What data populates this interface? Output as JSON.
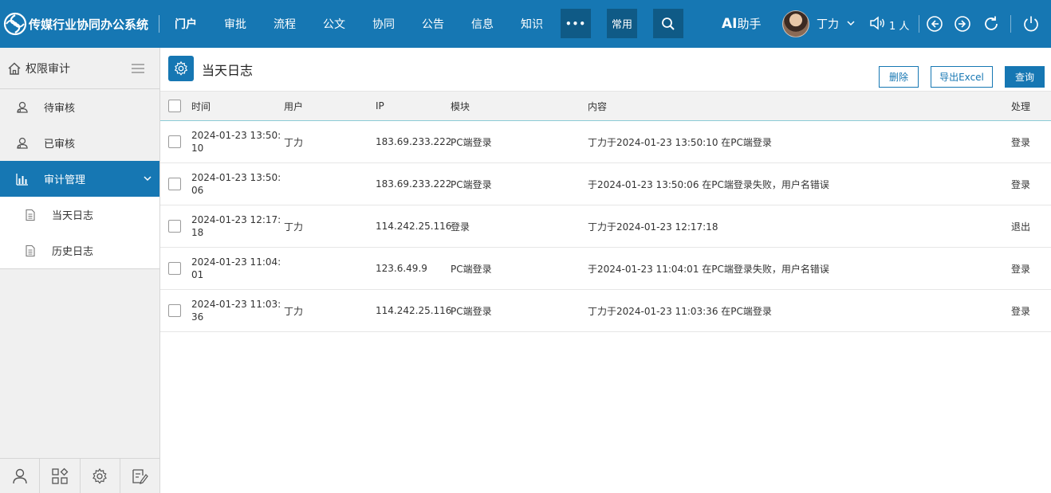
{
  "app": {
    "title": "传媒行业协同办公系统"
  },
  "nav": {
    "items": [
      "门户",
      "审批",
      "流程",
      "公文",
      "协同",
      "公告",
      "信息",
      "知识"
    ],
    "more_glyph": "•••",
    "common": "常用"
  },
  "topbar": {
    "ai_prefix": "AI",
    "ai_label": "助手",
    "user": "丁力",
    "online_count": "1 人"
  },
  "sidebar": {
    "title": "权限审计",
    "items": [
      {
        "label": "待审核",
        "icon": "audit-user-icon"
      },
      {
        "label": "已审核",
        "icon": "audit-user-icon"
      },
      {
        "label": "审计管理",
        "icon": "bar-chart-icon",
        "active": true
      }
    ],
    "subitems": [
      {
        "label": "当天日志",
        "icon": "document-icon"
      },
      {
        "label": "历史日志",
        "icon": "document-icon"
      }
    ],
    "bottom": [
      "user-icon",
      "apps-icon",
      "settings-icon",
      "edit-note-icon"
    ]
  },
  "page": {
    "title": "当天日志"
  },
  "buttons": {
    "delete": "删除",
    "export": "导出Excel",
    "query": "查询"
  },
  "table": {
    "headers": {
      "time": "时间",
      "user": "用户",
      "ip": "IP",
      "module": "模块",
      "content": "内容",
      "action": "处理"
    },
    "rows": [
      {
        "time": "2024-01-23 13:50:10",
        "user": "丁力",
        "ip": "183.69.233.222",
        "module": "PC端登录",
        "content": "丁力于2024-01-23 13:50:10  在PC端登录",
        "action": "登录"
      },
      {
        "time": "2024-01-23 13:50:06",
        "user": "",
        "ip": "183.69.233.222",
        "module": "PC端登录",
        "content": "于2024-01-23 13:50:06  在PC端登录失败，用户名错误",
        "action": "登录"
      },
      {
        "time": "2024-01-23 12:17:18",
        "user": "丁力",
        "ip": "114.242.25.116",
        "module": "登录",
        "content": "丁力于2024-01-23 12:17:18",
        "action": "退出"
      },
      {
        "time": "2024-01-23 11:04:01",
        "user": "",
        "ip": "123.6.49.9",
        "module": "PC端登录",
        "content": "于2024-01-23 11:04:01  在PC端登录失败，用户名错误",
        "action": "登录"
      },
      {
        "time": "2024-01-23 11:03:36",
        "user": "丁力",
        "ip": "114.242.25.116",
        "module": "PC端登录",
        "content": "丁力于2024-01-23 11:03:36  在PC端登录",
        "action": "登录"
      }
    ]
  },
  "colors": {
    "brand": "#1677b3",
    "brand_dark": "#0f5a86"
  }
}
